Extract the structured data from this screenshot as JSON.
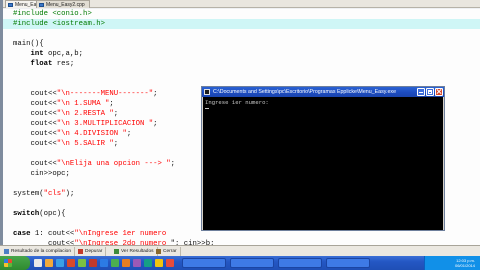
{
  "file_tabs": [
    "Menu_Easy.cpp",
    "Menu_Easy2.cpp"
  ],
  "editor": {
    "lines": [
      {
        "parts": [
          {
            "t": "#include <conio.h>",
            "c": "pp"
          }
        ],
        "highlight": false
      },
      {
        "parts": [
          {
            "t": "#include <iostream.h>",
            "c": "pp"
          }
        ],
        "highlight": true
      },
      {
        "parts": [],
        "highlight": false
      },
      {
        "parts": [
          {
            "t": "main(){",
            "c": ""
          }
        ],
        "highlight": false
      },
      {
        "parts": [
          {
            "t": "    ",
            "c": ""
          },
          {
            "t": "int",
            "c": "kw"
          },
          {
            "t": " opc,a,b;",
            "c": ""
          }
        ],
        "highlight": false
      },
      {
        "parts": [
          {
            "t": "    ",
            "c": ""
          },
          {
            "t": "float",
            "c": "kw"
          },
          {
            "t": " res;",
            "c": ""
          }
        ],
        "highlight": false
      },
      {
        "parts": [],
        "highlight": false
      },
      {
        "parts": [],
        "highlight": false
      },
      {
        "parts": [
          {
            "t": "    cout<<",
            "c": ""
          },
          {
            "t": "\"\\n-------MENU-------\"",
            "c": "str"
          },
          {
            "t": ";",
            "c": ""
          }
        ],
        "highlight": false
      },
      {
        "parts": [
          {
            "t": "    cout<<",
            "c": ""
          },
          {
            "t": "\"\\n 1.SUMA \"",
            "c": "str"
          },
          {
            "t": ";",
            "c": ""
          }
        ],
        "highlight": false
      },
      {
        "parts": [
          {
            "t": "    cout<<",
            "c": ""
          },
          {
            "t": "\"\\n 2.RESTA \"",
            "c": "str"
          },
          {
            "t": ";",
            "c": ""
          }
        ],
        "highlight": false
      },
      {
        "parts": [
          {
            "t": "    cout<<",
            "c": ""
          },
          {
            "t": "\"\\n 3.MULTIPLICACION \"",
            "c": "str"
          },
          {
            "t": ";",
            "c": ""
          }
        ],
        "highlight": false
      },
      {
        "parts": [
          {
            "t": "    cout<<",
            "c": ""
          },
          {
            "t": "\"\\n 4.DIVISION \"",
            "c": "str"
          },
          {
            "t": ";",
            "c": ""
          }
        ],
        "highlight": false
      },
      {
        "parts": [
          {
            "t": "    cout<<",
            "c": ""
          },
          {
            "t": "\"\\n 5.SALIR \"",
            "c": "str"
          },
          {
            "t": ";",
            "c": ""
          }
        ],
        "highlight": false
      },
      {
        "parts": [],
        "highlight": false
      },
      {
        "parts": [
          {
            "t": "    cout<<",
            "c": ""
          },
          {
            "t": "\"\\nElija una opcion ---> \"",
            "c": "str"
          },
          {
            "t": ";",
            "c": ""
          }
        ],
        "highlight": false
      },
      {
        "parts": [
          {
            "t": "    cin>>opc;",
            "c": ""
          }
        ],
        "highlight": false
      },
      {
        "parts": [],
        "highlight": false
      },
      {
        "parts": [
          {
            "t": "system(",
            "c": ""
          },
          {
            "t": "\"cls\"",
            "c": "str"
          },
          {
            "t": ");",
            "c": ""
          }
        ],
        "highlight": false
      },
      {
        "parts": [],
        "highlight": false
      },
      {
        "parts": [
          {
            "t": "switch",
            "c": "kw"
          },
          {
            "t": "(opc){",
            "c": ""
          }
        ],
        "highlight": false
      },
      {
        "parts": [],
        "highlight": false
      },
      {
        "parts": [
          {
            "t": "case",
            "c": "kw"
          },
          {
            "t": " 1: cout<<",
            "c": ""
          },
          {
            "t": "\"\\nIngrese 1er numero",
            "c": "str"
          }
        ],
        "highlight": false
      },
      {
        "parts": [
          {
            "t": "        cout<<",
            "c": ""
          },
          {
            "t": "\"\\nIngrese 2do numero",
            "c": "str"
          },
          {
            "t": " \"; cin>>b;",
            "c": ""
          }
        ],
        "highlight": false
      }
    ]
  },
  "console": {
    "title": "C:\\Documents and Settings\\pc\\Escritorio\\Programas Epplicke\\Menu_Easy.exe",
    "text": "Ingrese 1er numero:"
  },
  "panel_tabs": [
    "Resultado de la compilacion",
    "Depurar",
    "Ver Resultados",
    "Cerrar"
  ],
  "taskbar": {
    "clock": "12:03 p.m.\n06/01/2014"
  },
  "colors": {
    "preprocessor": "#007a00",
    "string": "#ff0000",
    "line_highlight": "#cff6f6",
    "titlebar": "#1c4cc0"
  }
}
